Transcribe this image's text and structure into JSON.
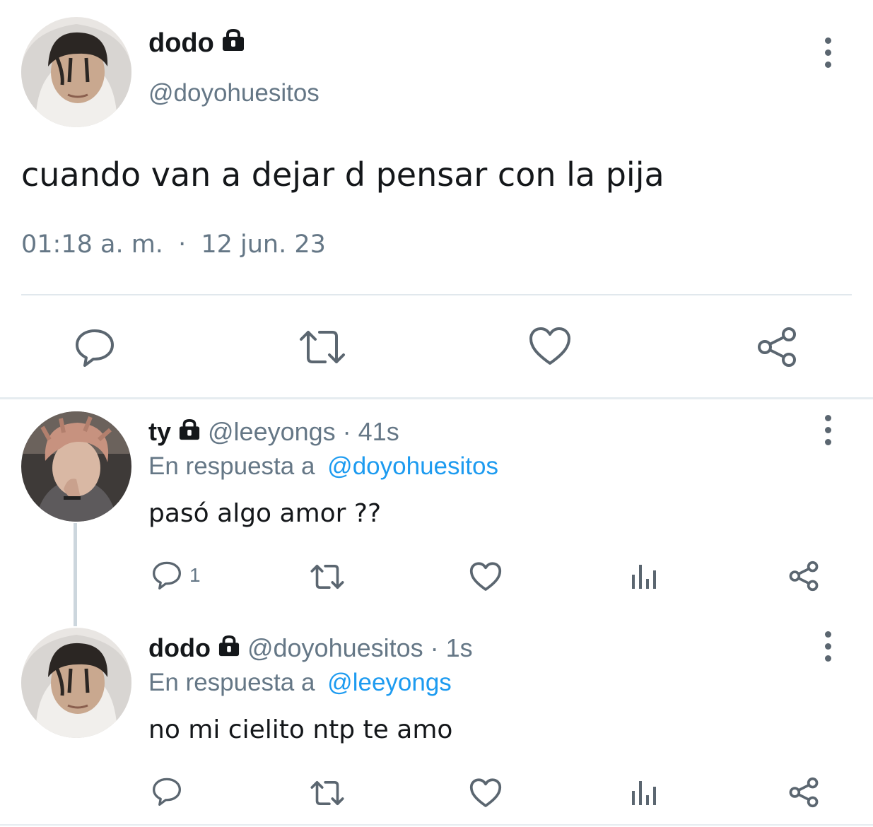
{
  "main_tweet": {
    "name": "dodo",
    "handle": "@doyohuesitos",
    "text": "cuando van a dejar d pensar con la pija",
    "time": "01:18 a. m.",
    "separator": "·",
    "date": "12 jun. 23"
  },
  "replies": [
    {
      "name": "ty",
      "handle": "@leeyongs",
      "age": "· 41s",
      "reply_prefix": "En respuesta a",
      "reply_to": "@doyohuesitos",
      "text": "pasó algo amor ??",
      "reply_count": "1"
    },
    {
      "name": "dodo",
      "handle": "@doyohuesitos",
      "age": "· 1s",
      "reply_prefix": "En respuesta a",
      "reply_to": "@leeyongs",
      "text": "no mi cielito ntp te amo",
      "reply_count": ""
    }
  ],
  "colors": {
    "icon": "#5b6670",
    "link": "#1d9bf0",
    "muted": "#657786"
  },
  "icons": [
    "lock-icon",
    "more-vert-icon",
    "reply-icon",
    "retweet-icon",
    "like-icon",
    "analytics-icon",
    "share-icon"
  ]
}
